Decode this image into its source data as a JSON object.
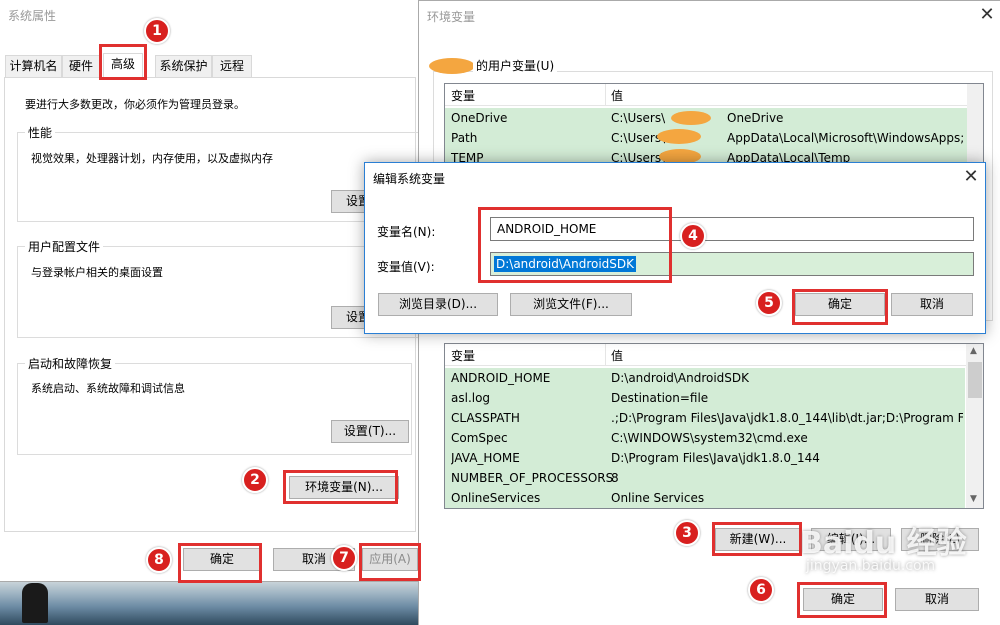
{
  "sysprops": {
    "title": "系统属性",
    "tabs": [
      "计算机名",
      "硬件",
      "高级",
      "系统保护",
      "远程"
    ],
    "admin_note": "要进行大多数更改，你必须作为管理员登录。",
    "perf_label": "性能",
    "perf_desc": "视觉效果，处理器计划，内存使用，以及虚拟内存",
    "perf_btn": "设置",
    "profile_label": "用户配置文件",
    "profile_desc": "与登录帐户相关的桌面设置",
    "profile_btn": "设置",
    "startup_label": "启动和故障恢复",
    "startup_desc": "系统启动、系统故障和调试信息",
    "startup_btn": "设置(T)...",
    "envvars_btn": "环境变量(N)...",
    "ok": "确定",
    "cancel": "取消",
    "apply": "应用(A)"
  },
  "envvars": {
    "title": "环境变量",
    "user_group_label": "的用户变量(U)",
    "col_var": "变量",
    "col_val": "值",
    "user_rows": [
      {
        "name": "OneDrive",
        "value": "C:\\Users\\",
        "value_tail": "OneDrive"
      },
      {
        "name": "Path",
        "value": "C:\\Users\\",
        "value_tail": "AppData\\Local\\Microsoft\\WindowsApps;"
      },
      {
        "name": "TEMP",
        "value": "C:\\Users\\",
        "value_tail": "AppData\\Local\\Temp"
      }
    ],
    "sys_rows": [
      {
        "name": "ANDROID_HOME",
        "value": "D:\\android\\AndroidSDK"
      },
      {
        "name": "asl.log",
        "value": "Destination=file"
      },
      {
        "name": "CLASSPATH",
        "value": ".;D:\\Program Files\\Java\\jdk1.8.0_144\\lib\\dt.jar;D:\\Program File..."
      },
      {
        "name": "ComSpec",
        "value": "C:\\WINDOWS\\system32\\cmd.exe"
      },
      {
        "name": "JAVA_HOME",
        "value": "D:\\Program Files\\Java\\jdk1.8.0_144"
      },
      {
        "name": "NUMBER_OF_PROCESSORS",
        "value": "8"
      },
      {
        "name": "OnlineServices",
        "value": "Online Services"
      }
    ],
    "new_btn": "新建(W)...",
    "edit_btn": "编辑(I)...",
    "delete_btn": "删除(L)",
    "ok": "确定",
    "cancel": "取消"
  },
  "editdlg": {
    "title": "编辑系统变量",
    "name_label": "变量名(N):",
    "name_value": "ANDROID_HOME",
    "value_label": "变量值(V):",
    "value_value": "D:\\android\\AndroidSDK",
    "browse_dir": "浏览目录(D)...",
    "browse_file": "浏览文件(F)...",
    "ok": "确定",
    "cancel": "取消"
  },
  "badges": [
    "1",
    "2",
    "3",
    "4",
    "5",
    "6",
    "7",
    "8"
  ],
  "watermark": {
    "text": "Baidu 经验",
    "url": "jingyan.baidu.com"
  },
  "colors": {
    "annotation_red": "#e0302f",
    "row_highlight": "#d3ecd6",
    "selection_blue": "#0078d7"
  }
}
